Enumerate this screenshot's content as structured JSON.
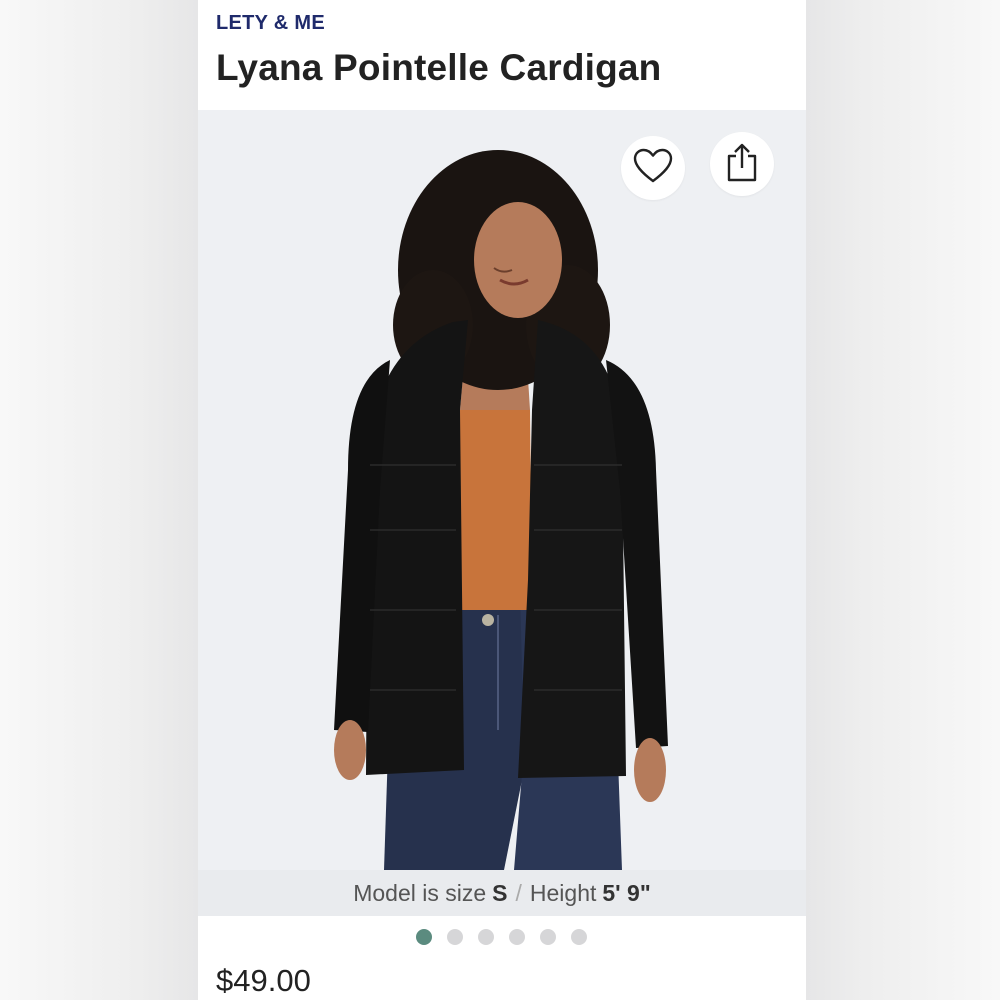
{
  "product": {
    "brand": "LETY & ME",
    "title": "Lyana Pointelle Cardigan",
    "price": "$49.00"
  },
  "model_info": {
    "prefix": "Model is size",
    "size": "S",
    "separator": "/",
    "height_label": "Height",
    "height": "5' 9\""
  },
  "carousel": {
    "total": 6,
    "active_index": 0
  },
  "icons": {
    "favorite": "heart-icon",
    "share": "share-icon"
  },
  "colors": {
    "brand": "#1f2a6b",
    "active_dot": "#5b8b7f",
    "inactive_dot": "#d6d6d8"
  }
}
